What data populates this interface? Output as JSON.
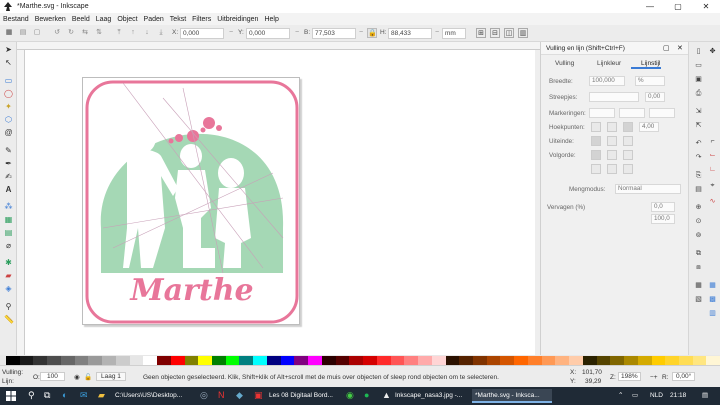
{
  "window": {
    "title": "*Marthe.svg - Inkscape",
    "minimize": "—",
    "maximize": "▢",
    "close": "✕"
  },
  "menu": [
    "Bestand",
    "Bewerken",
    "Beeld",
    "Laag",
    "Object",
    "Paden",
    "Tekst",
    "Filters",
    "Uitbreidingen",
    "Help"
  ],
  "toolbar": {
    "x_label": "X:",
    "x_value": "0,000",
    "y_label": "Y:",
    "y_value": "0,000",
    "b_label": "B:",
    "b_value": "77,503",
    "h_label": "H:",
    "h_value": "88,433",
    "unit": "mm"
  },
  "canvas": {
    "artwork_text": "Marthe"
  },
  "dock": {
    "title": "Vulling en lijn (Shift+Ctrl+F)",
    "tabs": [
      "Vulling",
      "Lijnkleur",
      "Lijnstijl"
    ],
    "width_label": "Breedte:",
    "width_value": "100,000",
    "width_unit": "%",
    "dashes_label": "Streepjes:",
    "dashes_value": "0,00",
    "markers_label": "Markeringen:",
    "join_label": "Hoekpunten:",
    "join_value": "4,00",
    "cap_label": "Uiteinde:",
    "order_label": "Volgorde:",
    "blend_label": "Mengmodus:",
    "blend_value": "Normaal",
    "blur_label": "Vervagen (%)",
    "blur_value": "0,0",
    "opacity_value": "100,0"
  },
  "status": {
    "fill_label": "Vulling:",
    "stroke_label": "Lijn:",
    "opacity_label": "O:",
    "opacity_value": "100",
    "layer": "Laag 1",
    "message": "Geen objecten geselecteerd. Klik, Shift+klik of Alt+scroll met de muis over objecten of sleep rond objecten om te selecteren.",
    "x_label": "X:",
    "x_value": "101,70",
    "y_label": "Y:",
    "y_value": "39,29",
    "zoom_label": "Z:",
    "zoom_value": "198%",
    "rot_label": "R:",
    "rot_value": "0,00°"
  },
  "taskbar": {
    "items": [
      "C:\\Users\\US\\Desktop...",
      "Les 08 Digitaal Bord...",
      "Inkscape_nasa3.jpg -...",
      "*Marthe.svg - Inksca..."
    ],
    "lang": "NLD",
    "time": "21:18"
  },
  "colors": {
    "accent_pink": "#e8769a",
    "silhouette_green": "#a5d8b5",
    "taskbar": "#1f2a36"
  }
}
